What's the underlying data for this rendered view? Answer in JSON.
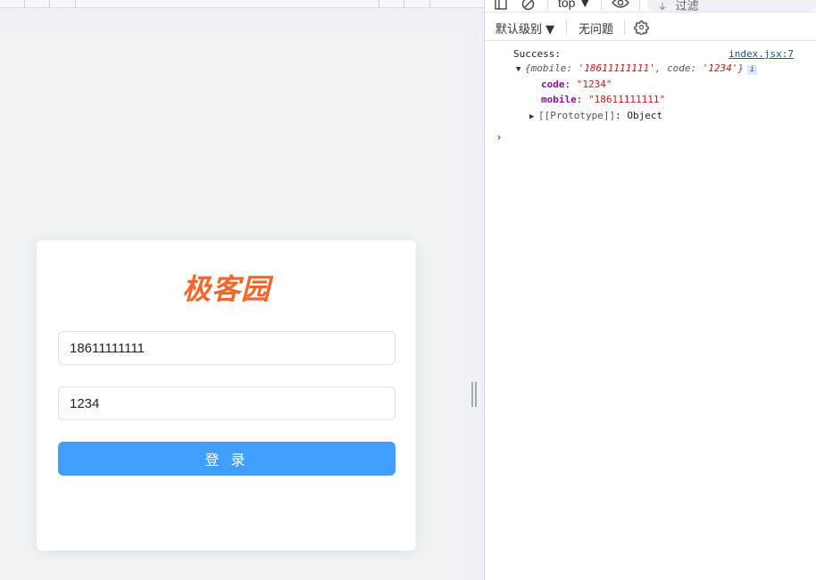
{
  "login": {
    "logo": "极客园",
    "mobile_value": "18611111111",
    "code_value": "1234",
    "submit_label": "登 录"
  },
  "devtools": {
    "context": "top ▼",
    "filter_placeholder": "过滤",
    "level_label": "默认级别 ▼",
    "issues_label": "无问题",
    "log_message": "Success:",
    "source_link": "index.jsx:7",
    "object_preview_prefix": "{mobile: ",
    "object_preview_mobile": "'18611111111'",
    "object_preview_mid": ", code: ",
    "object_preview_code": "'1234'",
    "object_preview_suffix": "}",
    "prop_code_key": "code",
    "prop_code_value": "\"1234\"",
    "prop_mobile_key": "mobile",
    "prop_mobile_value": "\"18611111111\"",
    "prototype_label": "[[Prototype]]",
    "prototype_value": "Object"
  },
  "colors": {
    "brand": "#f2662b",
    "primary_button": "#409eff",
    "console_key": "#881391",
    "console_string": "#c41a16"
  }
}
